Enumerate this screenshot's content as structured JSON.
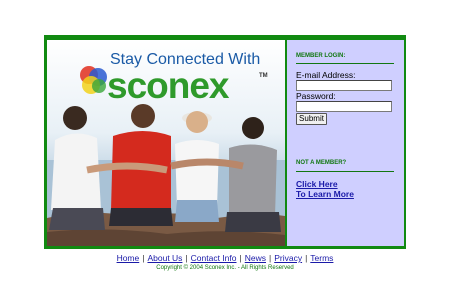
{
  "hero": {
    "tagline": "Stay Connected With",
    "brand": "sconex",
    "trademark": "TM",
    "image_alt": "Four friends sitting arm in arm looking at the sea"
  },
  "login": {
    "section_title": "MEMBER LOGIN:",
    "email_label": "E-mail Address:",
    "email_value": "",
    "password_label": "Password:",
    "password_value": "",
    "submit_label": "Submit"
  },
  "promo": {
    "section_title": "NOT A MEMBER?",
    "link_line1": "Click Here",
    "link_line2": "To Learn More"
  },
  "footer": {
    "links": [
      "Home",
      "About Us",
      "Contact Info",
      "News",
      "Privacy",
      "Terms"
    ],
    "separator": "|",
    "copyright": "Copyright © 2004 Sconex Inc. - All Rights Reserved"
  },
  "colors": {
    "frame_green": "#118a11",
    "panel_lavender": "#cfcfff",
    "tagline_blue": "#1a5aa6",
    "brand_green": "#2f9a2b",
    "link_blue": "#1a1aa8"
  }
}
